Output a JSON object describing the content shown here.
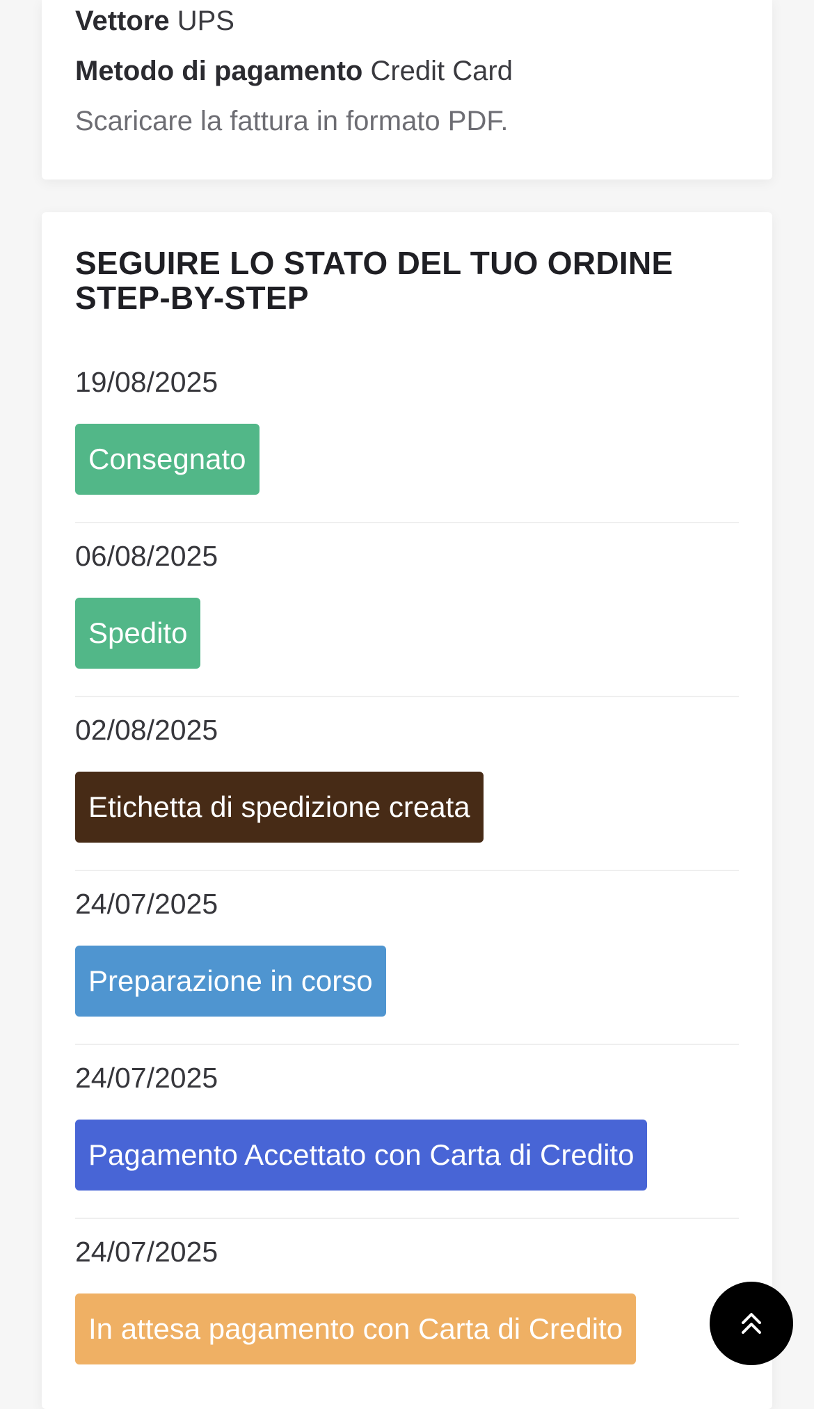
{
  "order_info": {
    "carrier_label": "Vettore",
    "carrier_value": "UPS",
    "payment_label": "Metodo di pagamento",
    "payment_value": "Credit Card",
    "invoice_link": "Scaricare la fattura in formato PDF."
  },
  "tracking": {
    "title": "SEGUIRE LO STATO DEL TUO ORDINE STEP-BY-STEP",
    "steps": [
      {
        "date": "19/08/2025",
        "status": "Consegnato",
        "color": "#52b788"
      },
      {
        "date": "06/08/2025",
        "status": "Spedito",
        "color": "#52b788"
      },
      {
        "date": "02/08/2025",
        "status": "Etichetta di spedizione creata",
        "color": "#472b16"
      },
      {
        "date": "24/07/2025",
        "status": "Preparazione in corso",
        "color": "#4f95d0"
      },
      {
        "date": "24/07/2025",
        "status": "Pagamento Accettato con Carta di Credito",
        "color": "#4865d6"
      },
      {
        "date": "24/07/2025",
        "status": "In attesa pagamento con Carta di Credito",
        "color": "#efb064"
      }
    ]
  },
  "scroll_top": {
    "icon": "double-chevron-up-icon"
  }
}
